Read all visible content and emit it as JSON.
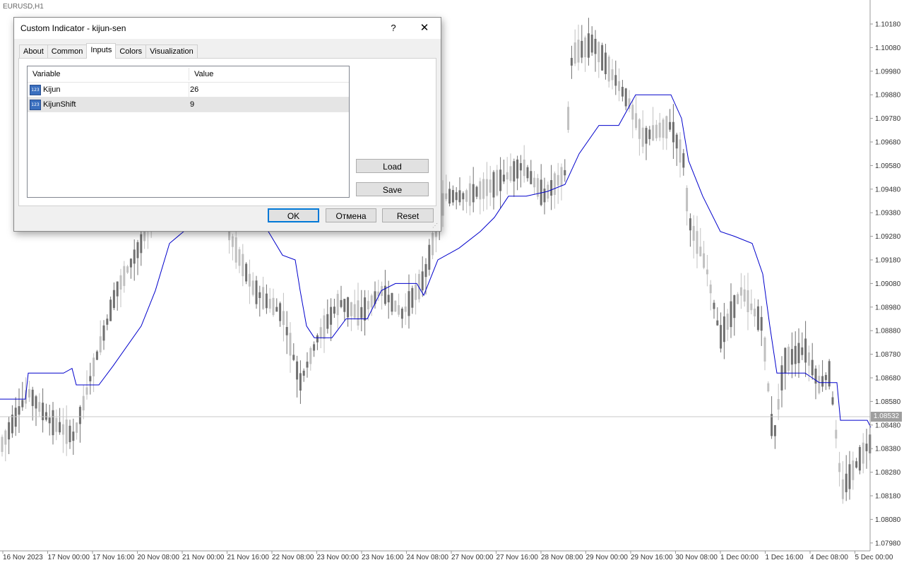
{
  "chart": {
    "symbol_label": "EURUSD,H1",
    "current_price": "1.08532",
    "price_ticks": [
      "1.10180",
      "1.10080",
      "1.09980",
      "1.09880",
      "1.09780",
      "1.09680",
      "1.09580",
      "1.09480",
      "1.09380",
      "1.09280",
      "1.09180",
      "1.09080",
      "1.08980",
      "1.08880",
      "1.08780",
      "1.08680",
      "1.08580",
      "1.08480",
      "1.08380",
      "1.08280",
      "1.08180",
      "1.08080",
      "1.07980"
    ],
    "time_ticks": [
      "16 Nov 2023",
      "17 Nov 00:00",
      "17 Nov 16:00",
      "20 Nov 08:00",
      "21 Nov 00:00",
      "21 Nov 16:00",
      "22 Nov 08:00",
      "23 Nov 00:00",
      "23 Nov 16:00",
      "24 Nov 08:00",
      "27 Nov 00:00",
      "27 Nov 16:00",
      "28 Nov 08:00",
      "29 Nov 00:00",
      "29 Nov 16:00",
      "30 Nov 08:00",
      "1 Dec 00:00",
      "1 Dec 16:00",
      "4 Dec 08:00",
      "5 Dec 00:00"
    ],
    "colors": {
      "kijun_line": "#0000cc",
      "bull_candle": "#c0c0c0",
      "bear_candle": "#707070",
      "price_line": "#c8c8c8"
    }
  },
  "chart_data": {
    "type": "line",
    "title": "",
    "xlabel": "",
    "ylabel": "",
    "ylim": [
      1.0795,
      1.1021
    ],
    "kijun_series": [
      [
        0,
        1.0859
      ],
      [
        36,
        1.0859
      ],
      [
        40,
        1.087
      ],
      [
        90,
        1.087
      ],
      [
        102,
        1.0872
      ],
      [
        108,
        1.0865
      ],
      [
        140,
        1.0865
      ],
      [
        160,
        1.0873
      ],
      [
        200,
        1.089
      ],
      [
        220,
        1.0905
      ],
      [
        240,
        1.0925
      ],
      [
        260,
        1.093
      ],
      [
        275,
        1.0945
      ],
      [
        380,
        1.093
      ],
      [
        400,
        1.092
      ],
      [
        418,
        1.0918
      ],
      [
        425,
        1.0905
      ],
      [
        434,
        1.089
      ],
      [
        445,
        1.0885
      ],
      [
        470,
        1.0885
      ],
      [
        490,
        1.0893
      ],
      [
        520,
        1.0893
      ],
      [
        540,
        1.0905
      ],
      [
        560,
        1.0908
      ],
      [
        590,
        1.0908
      ],
      [
        600,
        1.0903
      ],
      [
        620,
        1.0918
      ],
      [
        650,
        1.0923
      ],
      [
        680,
        1.093
      ],
      [
        700,
        1.0936
      ],
      [
        720,
        1.0945
      ],
      [
        745,
        1.0945
      ],
      [
        775,
        1.0947
      ],
      [
        800,
        1.095
      ],
      [
        820,
        1.0963
      ],
      [
        848,
        1.0975
      ],
      [
        876,
        1.0975
      ],
      [
        900,
        1.0988
      ],
      [
        950,
        1.0988
      ],
      [
        965,
        1.0978
      ],
      [
        975,
        1.096
      ],
      [
        995,
        1.0945
      ],
      [
        1020,
        1.093
      ],
      [
        1040,
        1.0928
      ],
      [
        1065,
        1.0925
      ],
      [
        1080,
        1.0912
      ],
      [
        1090,
        1.089
      ],
      [
        1100,
        1.087
      ],
      [
        1140,
        1.087
      ],
      [
        1150,
        1.0868
      ],
      [
        1160,
        1.0866
      ],
      [
        1185,
        1.0866
      ],
      [
        1190,
        1.085
      ],
      [
        1228,
        1.085
      ],
      [
        1233,
        1.0847
      ]
    ]
  },
  "dialog": {
    "title": "Custom Indicator - kijun-sen",
    "help_label": "?",
    "close_label": "✕",
    "tabs": [
      {
        "label": "About"
      },
      {
        "label": "Common"
      },
      {
        "label": "Inputs"
      },
      {
        "label": "Colors"
      },
      {
        "label": "Visualization"
      }
    ],
    "active_tab": "Inputs",
    "grid": {
      "col_variable": "Variable",
      "col_value": "Value",
      "icon_text": "123",
      "rows": [
        {
          "variable": "Kijun",
          "value": "26"
        },
        {
          "variable": "KijunShift",
          "value": "9"
        }
      ]
    },
    "buttons": {
      "load": "Load",
      "save": "Save",
      "ok": "OK",
      "cancel": "Отмена",
      "reset": "Reset"
    }
  }
}
